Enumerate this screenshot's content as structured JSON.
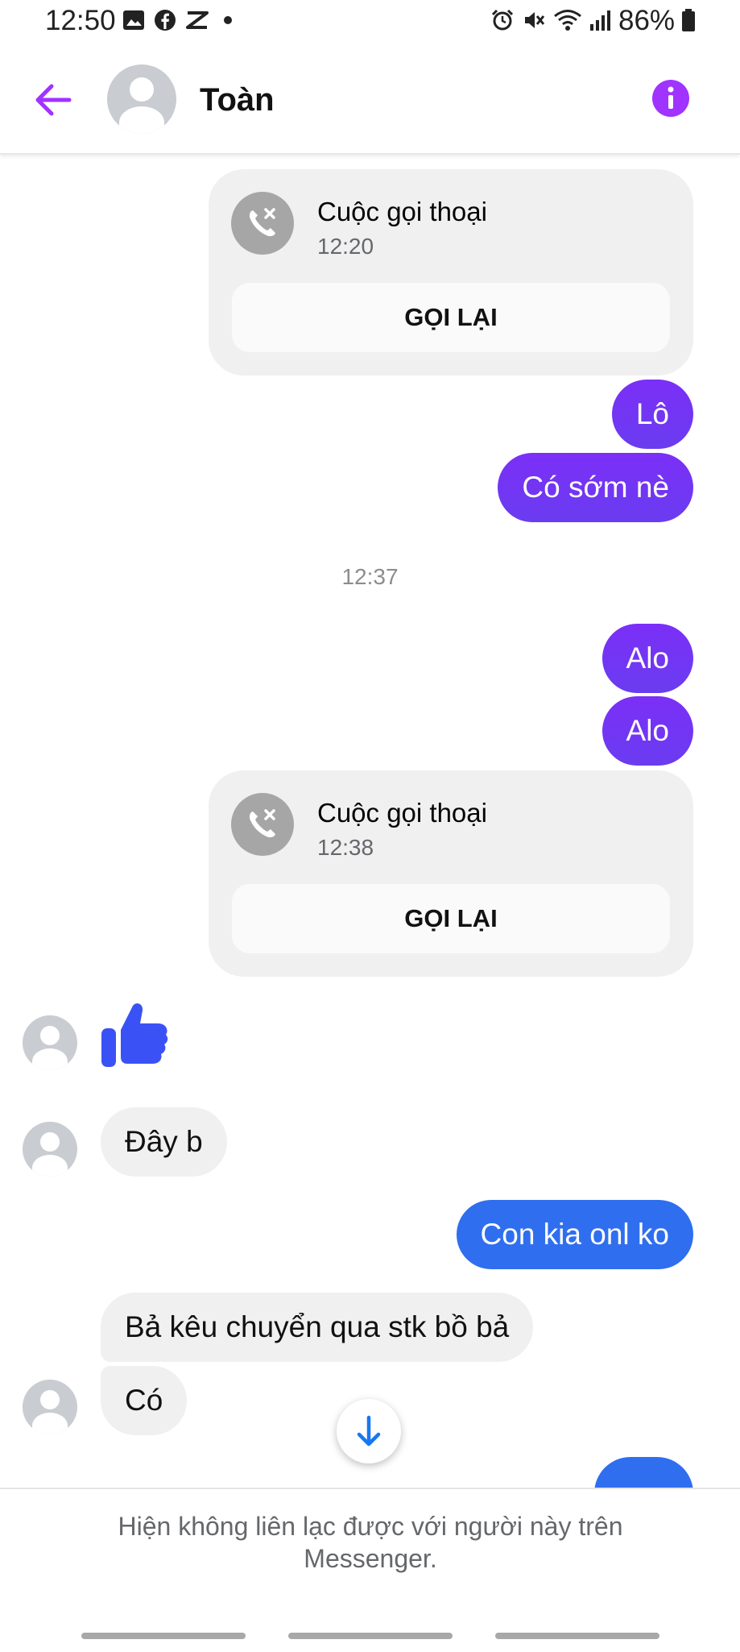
{
  "status_bar": {
    "time": "12:50",
    "battery": "86%"
  },
  "header": {
    "contact_name": "Toàn"
  },
  "colors": {
    "accent": "#a033ff",
    "sent_purple": "#7b2ff7",
    "sent_blue": "#2f6fef",
    "received_bg": "#f0f0f0"
  },
  "messages": {
    "call1": {
      "title": "Cuộc gọi thoại",
      "time": "12:20",
      "button": "GỌI LẠI"
    },
    "lo": "Lô",
    "co_som_ne": "Có sớm nè",
    "separator_time": "12:37",
    "alo1": "Alo",
    "alo2": "Alo",
    "call2": {
      "title": "Cuộc gọi thoại",
      "time": "12:38",
      "button": "GỌI LẠI"
    },
    "day_b": "Đây b",
    "con_kia": "Con kia onl ko",
    "ba_keu": "Bả kêu chuyển qua stk bồ bả",
    "co": "Có"
  },
  "footer": {
    "unavailable_text": "Hiện không liên lạc được với người này trên Messenger."
  }
}
